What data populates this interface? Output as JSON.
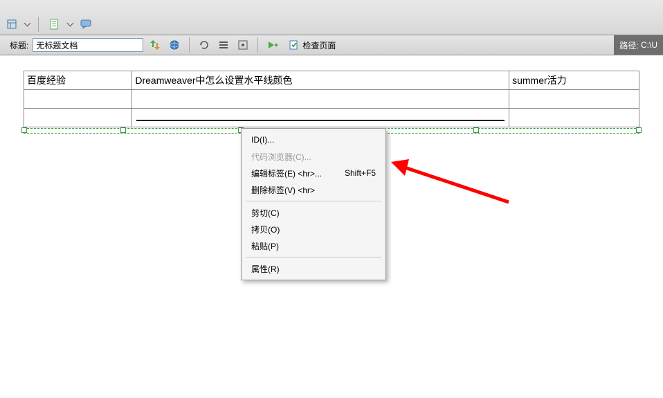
{
  "topbar": {},
  "toolbar": {
    "title_label": "标题:",
    "title_value": "无标题文档",
    "check_page": "检查页面"
  },
  "pathbar": {
    "label": "路径:",
    "value": "C:\\U"
  },
  "table": {
    "r0": {
      "c0": "百度经验",
      "c1": "Dreamweaver中怎么设置水平线颜色",
      "c2": "summer活力"
    },
    "r1": {
      "c0": "",
      "c1": "",
      "c2": ""
    },
    "r2": {
      "c0": "",
      "c1": "",
      "c2": ""
    }
  },
  "context_menu": {
    "id": {
      "label": "ID(I)..."
    },
    "browser": {
      "label": "代码浏览器(C)..."
    },
    "edit_tag": {
      "label": "编辑标签(E) <hr>...",
      "shortcut": "Shift+F5"
    },
    "del_tag": {
      "label": "删除标签(V) <hr>"
    },
    "cut": {
      "label": "剪切(C)"
    },
    "copy": {
      "label": "拷贝(O)"
    },
    "paste": {
      "label": "粘贴(P)"
    },
    "props": {
      "label": "属性(R)"
    }
  }
}
